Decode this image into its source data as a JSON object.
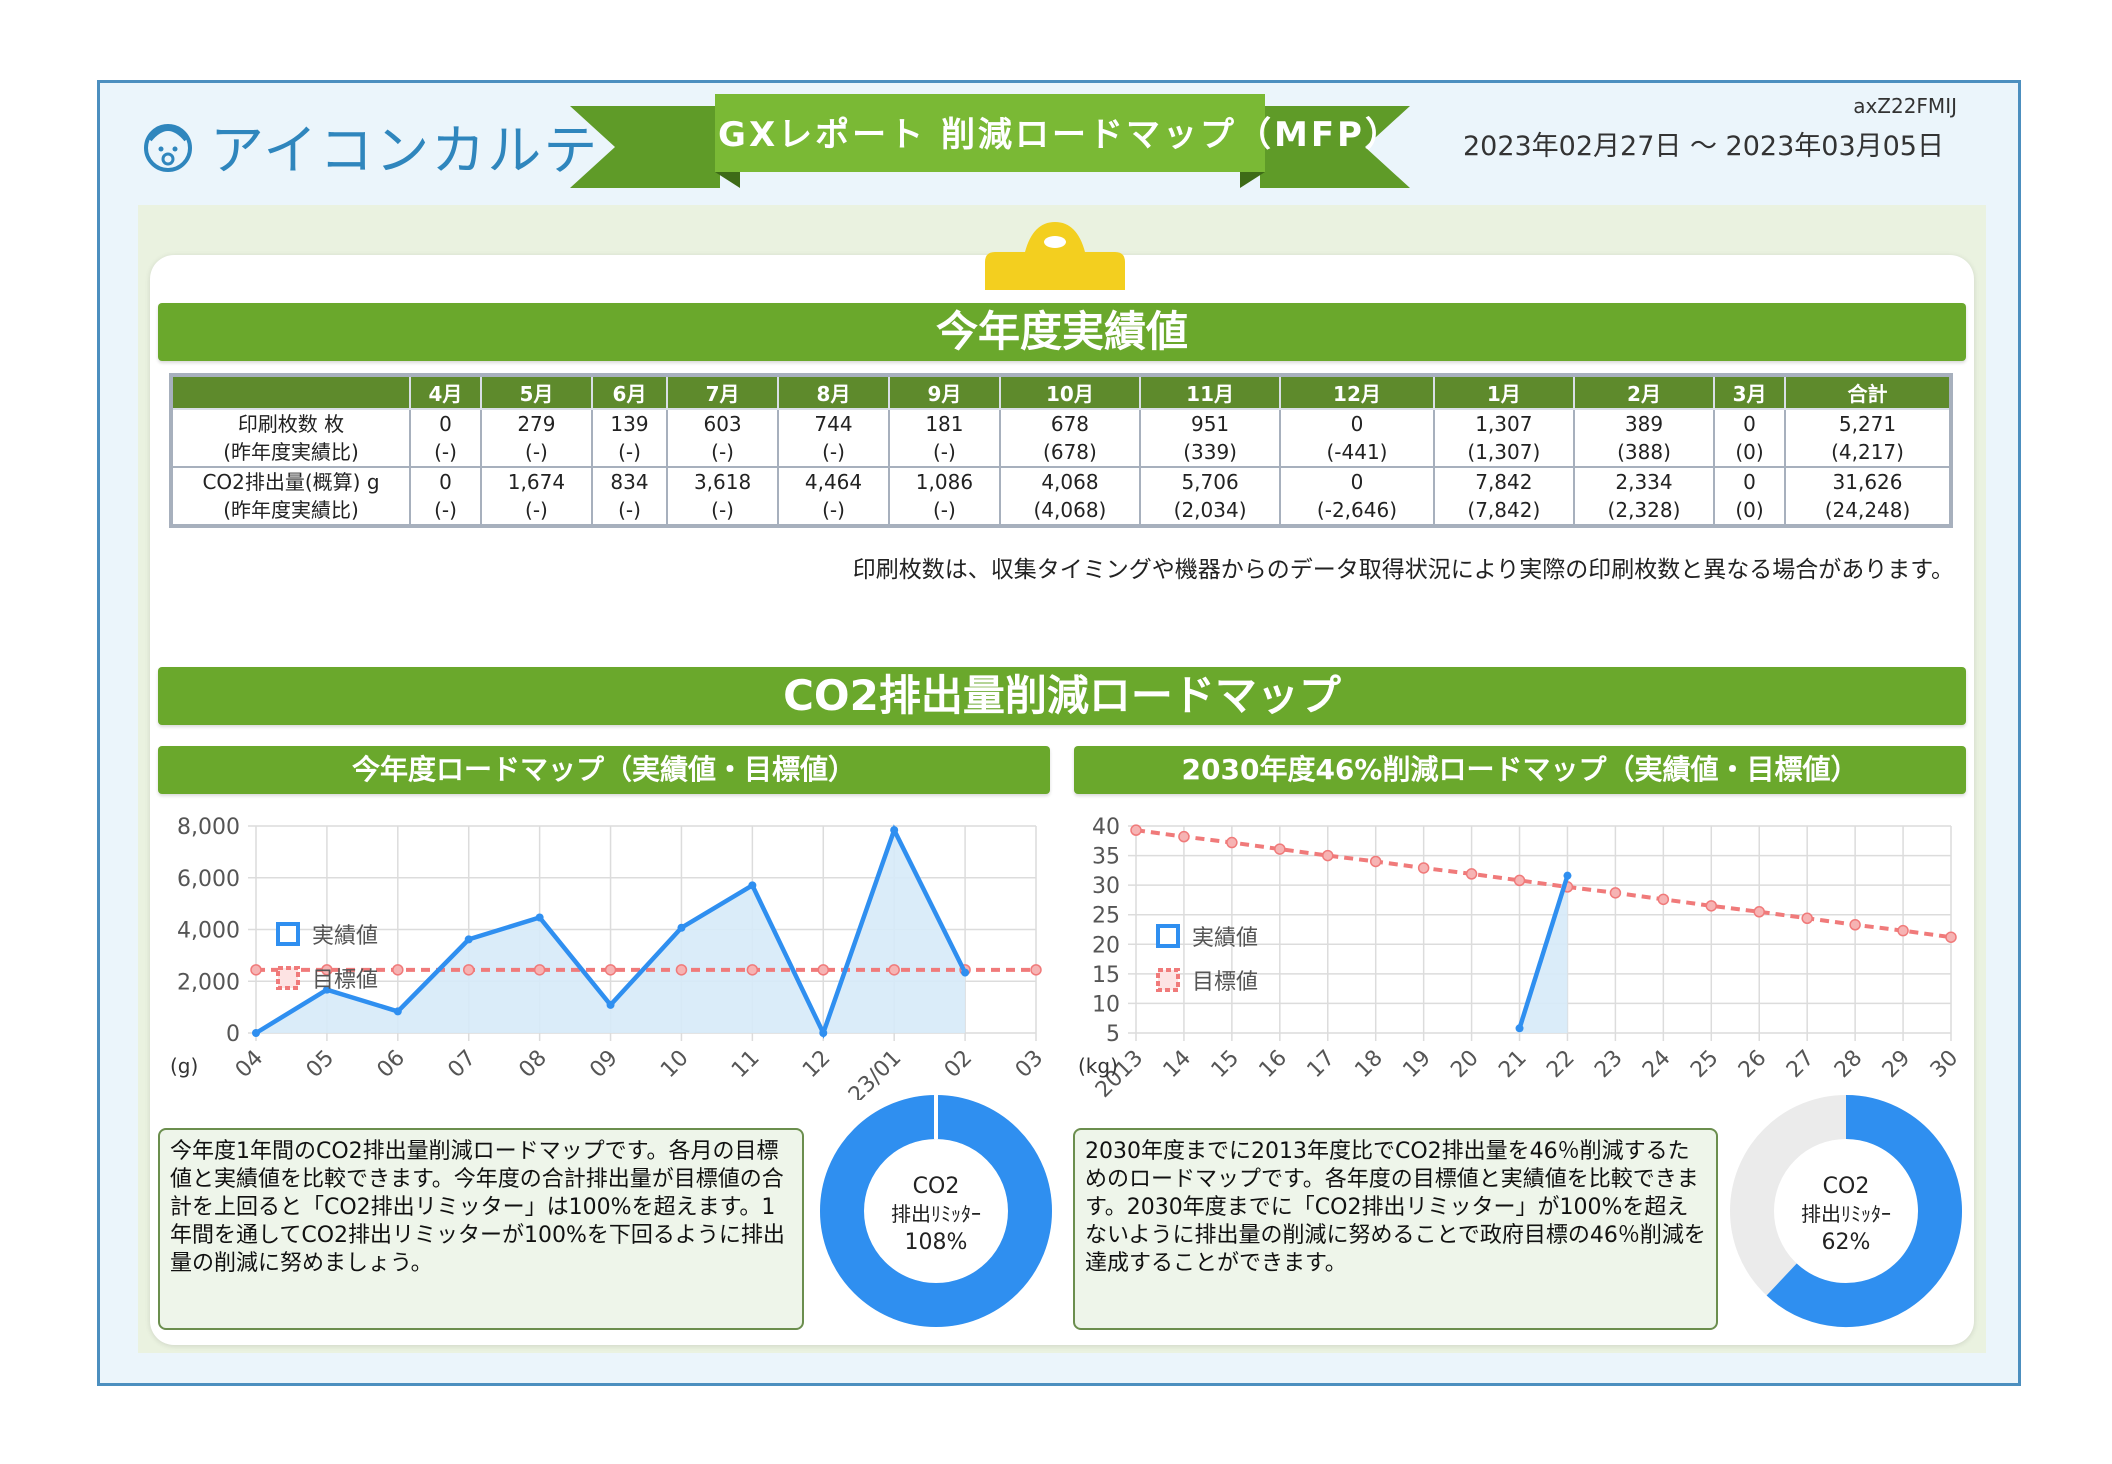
{
  "header": {
    "logo_text": "アイコンカルテ",
    "report_title": "GXレポート 削減ロードマップ（MFP）",
    "doc_id": "axZ22FMIJ",
    "period": "2023年02月27日 〜 2023年03月05日"
  },
  "performance": {
    "section_title": "今年度実績値",
    "months": [
      "4月",
      "5月",
      "6月",
      "7月",
      "8月",
      "9月",
      "10月",
      "11月",
      "12月",
      "1月",
      "2月",
      "3月",
      "合計"
    ],
    "rows": [
      {
        "label1": "印刷枚数 枚",
        "label2": "(昨年度実績比)",
        "values": [
          "0",
          "279",
          "139",
          "603",
          "744",
          "181",
          "678",
          "951",
          "0",
          "1,307",
          "389",
          "0",
          "5,271"
        ],
        "compare": [
          "(-)",
          "(-)",
          "(-)",
          "(-)",
          "(-)",
          "(-)",
          "(678)",
          "(339)",
          "(-441)",
          "(1,307)",
          "(388)",
          "(0)",
          "(4,217)"
        ]
      },
      {
        "label1": "CO2排出量(概算) g",
        "label2": "(昨年度実績比)",
        "values": [
          "0",
          "1,674",
          "834",
          "3,618",
          "4,464",
          "1,086",
          "4,068",
          "5,706",
          "0",
          "7,842",
          "2,334",
          "0",
          "31,626"
        ],
        "compare": [
          "(-)",
          "(-)",
          "(-)",
          "(-)",
          "(-)",
          "(-)",
          "(4,068)",
          "(2,034)",
          "(-2,646)",
          "(7,842)",
          "(2,328)",
          "(0)",
          "(24,248)"
        ]
      }
    ],
    "note": "印刷枚数は、収集タイミングや機器からのデータ取得状況により実際の印刷枚数と異なる場合があります。"
  },
  "roadmap": {
    "section_title": "CO2排出量削減ロードマップ",
    "left_title": "今年度ロードマップ（実績値・目標値）",
    "right_title": "2030年度46%削減ロードマップ（実績値・目標値）",
    "left_desc": "今年度1年間のCO2排出量削減ロードマップです。各月の目標値と実績値を比較できます。今年度の合計排出量が目標値の合計を上回ると「CO2排出リミッター」は100%を超えます。1年間を通してCO2排出リミッターが100%を下回るように排出量の削減に努めましょう。",
    "right_desc": "2030年度までに2013年度比でCO2排出量を46％削減するためのロードマップです。各年度の目標値と実績値を比較できます。2030年度までに「CO2排出リミッター」が100%を超えないように排出量の削減に努めることで政府目標の46％削減を達成することができます。",
    "left_gauge": {
      "line1": "CO2",
      "line2": "排出ﾘﾐｯﾀｰ",
      "value_text": "108%",
      "value": 1.08
    },
    "right_gauge": {
      "line1": "CO2",
      "line2": "排出ﾘﾐｯﾀｰ",
      "value_text": "62%",
      "value": 0.62
    },
    "colors": {
      "actual": "#2f8ff0",
      "target": "#f07a7a",
      "fill": "#d6eaf8",
      "gauge_bg": "#ebebeb",
      "green": "#6aa82c"
    }
  },
  "chart_data": [
    {
      "type": "line",
      "unit_label": "(g)",
      "categories": [
        "04",
        "05",
        "06",
        "07",
        "08",
        "09",
        "10",
        "11",
        "12",
        "23/01",
        "02",
        "03"
      ],
      "ylim": [
        0,
        8000
      ],
      "yticks": [
        "0",
        "2,000",
        "4,000",
        "6,000",
        "8,000"
      ],
      "legend_position": "left-middle",
      "grid": true,
      "series": [
        {
          "name": "実績値",
          "values": [
            0,
            1674,
            834,
            3618,
            4464,
            1086,
            4068,
            5706,
            0,
            7842,
            2334,
            null
          ]
        },
        {
          "name": "目標値",
          "values": [
            2440,
            2440,
            2440,
            2440,
            2440,
            2440,
            2440,
            2440,
            2440,
            2440,
            2440,
            2440
          ]
        }
      ]
    },
    {
      "type": "line",
      "unit_label": "(kg)",
      "categories": [
        "2013",
        "14",
        "15",
        "16",
        "17",
        "18",
        "19",
        "20",
        "21",
        "22",
        "23",
        "24",
        "25",
        "26",
        "27",
        "28",
        "29",
        "30"
      ],
      "ylim": [
        5,
        40
      ],
      "yticks": [
        "5",
        "10",
        "15",
        "20",
        "25",
        "30",
        "35",
        "40"
      ],
      "legend_position": "left-middle",
      "grid": true,
      "series": [
        {
          "name": "実績値",
          "values": [
            null,
            null,
            null,
            null,
            null,
            null,
            null,
            null,
            5.8,
            31.6,
            null,
            null,
            null,
            null,
            null,
            null,
            null,
            null
          ]
        },
        {
          "name": "目標値",
          "values": [
            39.3,
            38.2,
            37.2,
            36.1,
            35.0,
            34.0,
            32.9,
            31.9,
            30.8,
            29.7,
            28.7,
            27.6,
            26.5,
            25.5,
            24.4,
            23.3,
            22.3,
            21.2
          ]
        }
      ]
    }
  ]
}
